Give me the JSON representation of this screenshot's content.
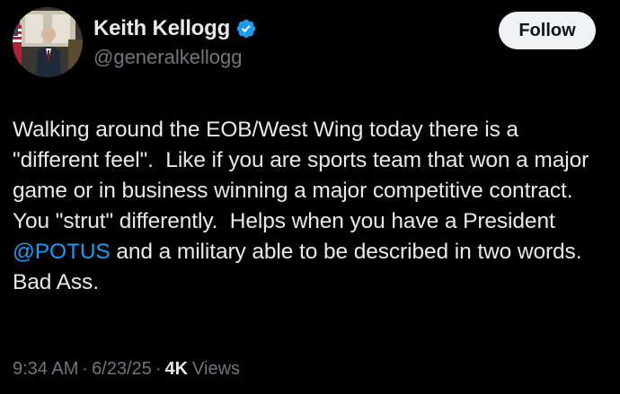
{
  "author": {
    "display_name": "Keith Kellogg",
    "handle": "@generalkellogg",
    "verified_icon": "verified-badge-icon"
  },
  "actions": {
    "follow_label": "Follow"
  },
  "tweet": {
    "text_before_mention": "Walking around the EOB/West Wing today there is a \"different feel\".  Like if you are sports team that won a major game or in business winning a major competitive contract. You \"strut\" differently.  Helps when you have a President ",
    "mention": "@POTUS",
    "text_after_mention": " and a military able to be described in two words.  Bad Ass."
  },
  "meta": {
    "time": "9:34 AM",
    "separator": "·",
    "date": "6/23/25",
    "views_count": "4K",
    "views_label": "Views"
  },
  "colors": {
    "background": "#000000",
    "text": "#e7e9ea",
    "secondary": "#71767b",
    "link": "#1d9bf0",
    "verified": "#1d9bf0"
  }
}
